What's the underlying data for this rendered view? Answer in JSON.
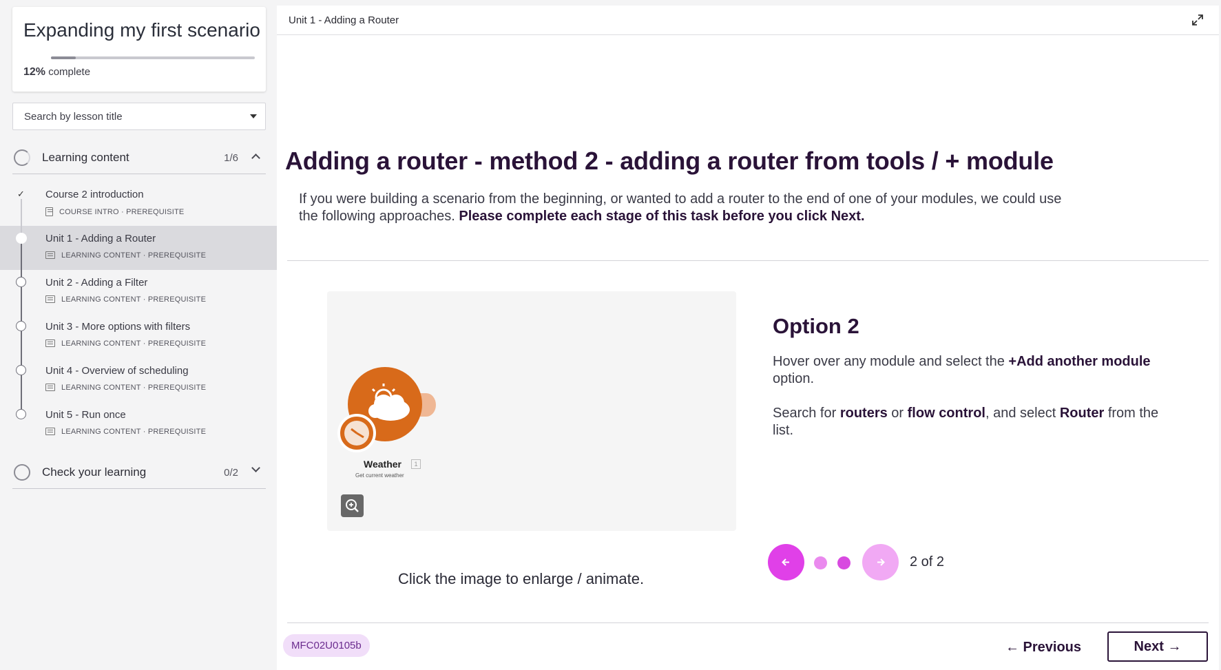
{
  "sidebar": {
    "course_title": "Expanding my first scenario",
    "progress_percent": "12%",
    "progress_suffix": "complete",
    "progress_value": 0.12,
    "search_placeholder": "Search by lesson title",
    "sections": [
      {
        "title": "Learning content",
        "count": "1/6",
        "expanded": true
      },
      {
        "title": "Check your learning",
        "count": "0/2",
        "expanded": false
      }
    ],
    "lessons": [
      {
        "title": "Course 2 introduction",
        "meta": "COURSE INTRO · PREREQUISITE",
        "icon": "page-icon",
        "status": "done"
      },
      {
        "title": "Unit 1 - Adding a Router",
        "meta": "LEARNING CONTENT · PREREQUISITE",
        "icon": "slides-icon",
        "status": "current"
      },
      {
        "title": "Unit 2 - Adding a Filter",
        "meta": "LEARNING CONTENT · PREREQUISITE",
        "icon": "slides-icon",
        "status": "todo"
      },
      {
        "title": "Unit 3 - More options with filters",
        "meta": "LEARNING CONTENT · PREREQUISITE",
        "icon": "slides-icon",
        "status": "todo"
      },
      {
        "title": "Unit 4 - Overview of scheduling",
        "meta": "LEARNING CONTENT · PREREQUISITE",
        "icon": "slides-icon",
        "status": "todo"
      },
      {
        "title": "Unit 5 - Run once",
        "meta": "LEARNING CONTENT · PREREQUISITE",
        "icon": "slides-icon",
        "status": "todo"
      }
    ]
  },
  "main": {
    "breadcrumb": "Unit 1 - Adding a Router",
    "heading": "Adding a router - method 2 - adding a router from tools / + module",
    "intro_plain": "If you were building a scenario from the beginning, or wanted to add a router to the end of one of your modules, we could use the following approaches. ",
    "intro_bold": "Please complete each stage of this task before you click Next.",
    "image": {
      "module_name": "Weather",
      "module_badge": "1",
      "module_sub": "Get current weather",
      "caption": "Click the image to enlarge / animate."
    },
    "option": {
      "title": "Option 2",
      "p1": [
        "Hover over any module and select the ",
        "+Add another module",
        " option."
      ],
      "p2": [
        "Search for ",
        "routers",
        " or ",
        "flow control",
        ", and select ",
        "Router",
        " from the list."
      ]
    },
    "carousel": {
      "counter": "2 of 2",
      "current": 2,
      "total": 2
    },
    "lesson_code": "MFC02U0105b",
    "previous_label": "Previous",
    "next_label": "Next"
  },
  "colors": {
    "accent": "#e040e8",
    "accent_light": "#f1a9f4",
    "heading": "#2a1338",
    "module_orange": "#d86a1a"
  }
}
